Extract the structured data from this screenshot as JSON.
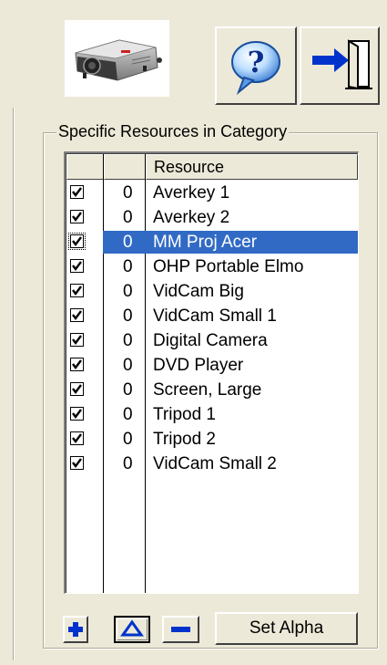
{
  "toolbar": {
    "device_image_icon": "projector-icon",
    "help_icon": "question-icon",
    "exit_icon": "exit-door-icon"
  },
  "group": {
    "title": "Specific Resources in Category"
  },
  "list": {
    "columns": [
      "",
      "",
      "Resource"
    ],
    "selected_row": 2,
    "rows": [
      {
        "checked": true,
        "count": "0",
        "name": "Averkey 1"
      },
      {
        "checked": true,
        "count": "0",
        "name": "Averkey 2"
      },
      {
        "checked": true,
        "count": "0",
        "name": "MM Proj Acer"
      },
      {
        "checked": true,
        "count": "0",
        "name": "OHP Portable Elmo"
      },
      {
        "checked": true,
        "count": "0",
        "name": "VidCam Big"
      },
      {
        "checked": true,
        "count": "0",
        "name": "VidCam Small 1"
      },
      {
        "checked": true,
        "count": "0",
        "name": "Digital Camera"
      },
      {
        "checked": true,
        "count": "0",
        "name": "DVD Player"
      },
      {
        "checked": true,
        "count": "0",
        "name": "Screen, Large"
      },
      {
        "checked": true,
        "count": "0",
        "name": "Tripod 1"
      },
      {
        "checked": true,
        "count": "0",
        "name": "Tripod 2"
      },
      {
        "checked": true,
        "count": "0",
        "name": "VidCam Small 2"
      }
    ]
  },
  "buttons": {
    "add_icon": "plus-icon",
    "up_icon": "triangle-up-icon",
    "remove_icon": "minus-icon",
    "set_alpha_label": "Set Alpha"
  },
  "colors": {
    "selection": "#316ac5",
    "icon_blue": "#0033cc"
  }
}
